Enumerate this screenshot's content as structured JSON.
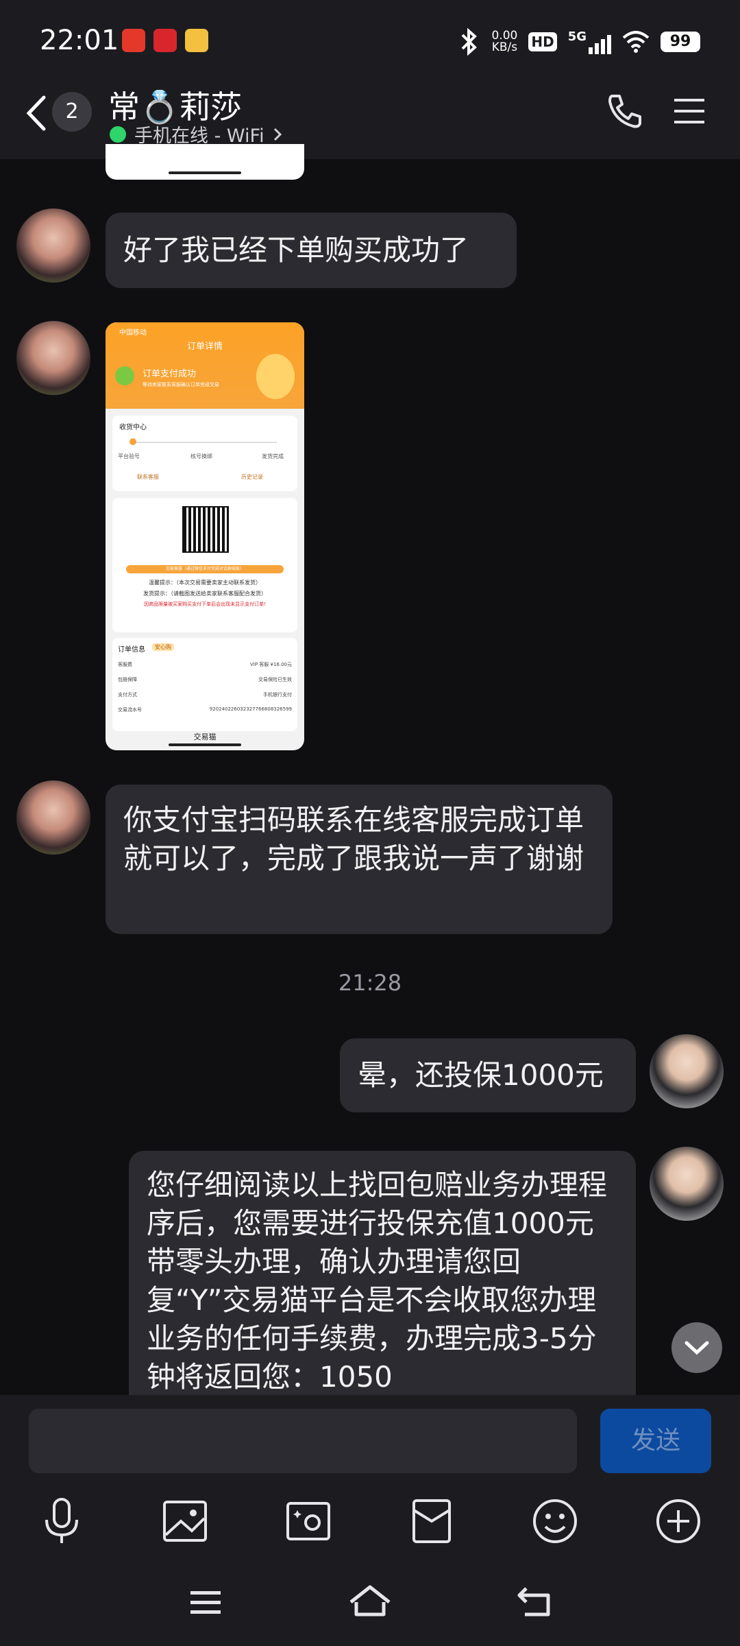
{
  "status_bar": {
    "time": "22:01",
    "net_speed_value": "0.00",
    "net_speed_unit": "KB/s",
    "hd": "HD",
    "network": "5G",
    "battery": "99"
  },
  "header": {
    "unread_count": "2",
    "contact_name": "常💍莉莎",
    "status": "手机在线 - WiFi",
    "status_color": "#2fd46a"
  },
  "messages": {
    "m1_text": "好了我已经下单购买成功了",
    "m3_text": "你支付宝扫码联系在线客服完成订单就可以了，完成了跟我说一声了谢谢",
    "time_divider": "21:28",
    "m4_text": "晕，还投保1000元",
    "m5_text": "您仔细阅读以上找回包赔业务办理程序后，您需要进行投保充值1000元带零头办理，确认办理请您回复“Y”交易猫平台是不会收取您办理业务的任何手续费，办理完成3-5分钟将返回您：1050"
  },
  "screenshot": {
    "carrier": "中国移动",
    "page_title": "订单详情",
    "pay_success": "订单支付成功",
    "pay_sub": "等待卖家联系客服确认订单完成交易",
    "receive_center": "收货中心",
    "steps": [
      "平台验号",
      "核号换绑",
      "发货完成"
    ],
    "contact_service": "联系客服",
    "history": "历史记录",
    "orange_bar": "交易客服（通过微信支付完成对话群结账）",
    "tip1": "温馨提示：（本次交易需要卖家主动联系发货）",
    "tip2": "发货提示：（请截图发送给卖家联系客服配合发货）",
    "warning": "因商品限量被买家购买支付下单后会出现未显示支付订单!",
    "order_info": "订单信息",
    "tag": "安心购",
    "rows": [
      {
        "k": "客服费",
        "v": "VIP 客服 ¥16.00元"
      },
      {
        "k": "包赔保障",
        "v": "交易保险已生效"
      },
      {
        "k": "支付方式",
        "v": "手机银行支付"
      },
      {
        "k": "交易流水号",
        "v": "920240226032327766808326599"
      }
    ],
    "brand": "交易猫"
  },
  "input": {
    "placeholder": "",
    "send_label": "发送"
  },
  "colors": {
    "accent": "#0c4aa0",
    "bubble": "#2b2b31",
    "background": "#0f0f12"
  }
}
